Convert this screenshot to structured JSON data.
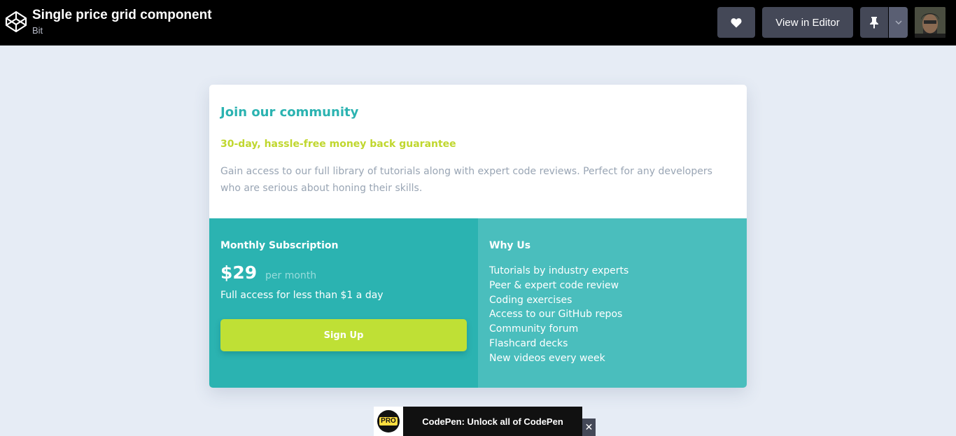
{
  "header": {
    "title": "Single price grid component",
    "author": "Bit",
    "heart_icon": "heart-icon",
    "view_editor_label": "View in Editor",
    "pin_icon": "pin-icon",
    "dropdown_icon": "chevron-down-icon"
  },
  "card": {
    "heading": "Join our community",
    "guarantee": "30-day, hassle-free money back guarantee",
    "description": "Gain access to our full library of tutorials along with expert code reviews. Perfect for any developers who are serious about honing their skills.",
    "subscription": {
      "title": "Monthly Subscription",
      "price": "$29",
      "period": "per month",
      "access": "Full access for less than $1 a day",
      "cta": "Sign Up"
    },
    "why": {
      "title": "Why Us",
      "items": [
        "Tutorials by industry experts",
        "Peer & expert code review",
        "Coding exercises",
        "Access to our GitHub repos",
        "Community forum",
        "Flashcard decks",
        "New videos every week"
      ]
    }
  },
  "pro_banner": {
    "badge": "PRO",
    "text": "CodePen: Unlock all of CodePen",
    "close": "✕"
  },
  "colors": {
    "teal": "#2bb3b1",
    "teal_light": "#4abebd",
    "lime": "#c0d72e",
    "background": "#e6ecf5"
  }
}
